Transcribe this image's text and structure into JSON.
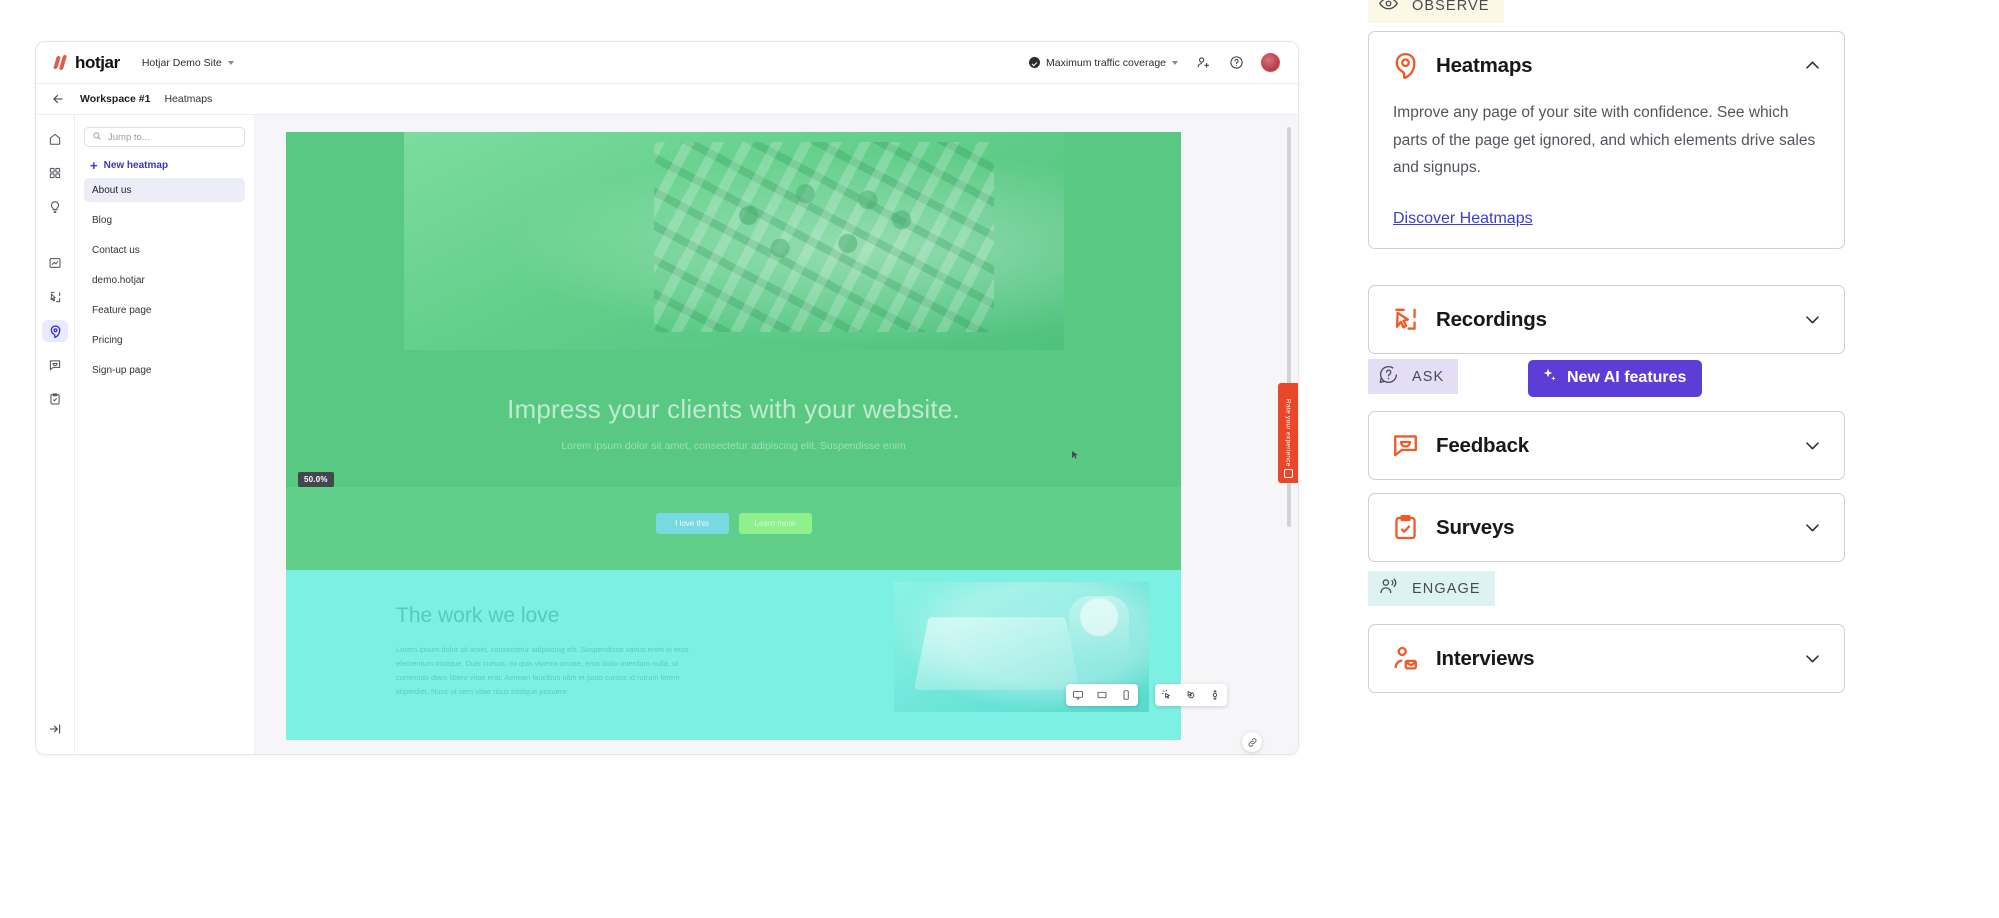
{
  "app": {
    "logo_text": "hotjar",
    "site_selector": "Hotjar Demo Site",
    "traffic_coverage": "Maximum traffic coverage",
    "icons": {
      "site_caret": "chevron-down-icon",
      "coverage_check": "check-circle-icon",
      "invite": "add-user-icon",
      "help": "help-circle-icon",
      "avatar": "user-avatar"
    },
    "breadcrumb": {
      "back": "back-arrow-icon",
      "workspace": "Workspace #1",
      "section": "Heatmaps"
    },
    "rail": [
      {
        "name": "home-icon"
      },
      {
        "name": "dashboard-grid-icon"
      },
      {
        "name": "lightbulb-icon"
      },
      {
        "name": "trends-chart-icon"
      },
      {
        "name": "recordings-icon"
      },
      {
        "name": "heatmaps-icon",
        "active": true
      },
      {
        "name": "feedback-icon"
      },
      {
        "name": "surveys-icon"
      }
    ],
    "rail_collapse": "collapse-panel-icon",
    "pagelist": {
      "search_placeholder": "Jump to...",
      "search_value": "",
      "new_heatmap": "New heatmap",
      "items": [
        {
          "label": "About us",
          "active": true
        },
        {
          "label": "Blog",
          "active": false
        },
        {
          "label": "Contact us",
          "active": false
        },
        {
          "label": "demo.hotjar",
          "active": false
        },
        {
          "label": "Feature page",
          "active": false
        },
        {
          "label": "Pricing",
          "active": false
        },
        {
          "label": "Sign-up page",
          "active": false
        }
      ]
    },
    "heatmap_preview": {
      "hero_heading": "Impress your clients with your website.",
      "hero_sub": "Lorem ipsum dolor sit amet, consectetur adipiscing elit. Suspendisse enim",
      "scroll_badge": "50.0%",
      "cta_primary": "I love this",
      "cta_secondary": "Learn more",
      "section_heading": "The work we love",
      "section_paragraph": "Lorem ipsum dolor sit amet, consectetur adipiscing elit. Suspendisse varius enim in eros elementum tristique. Duis cursus, mi quis viverra ornare, eros dolor interdum nulla, ut commodo diam libero vitae erat. Aenean faucibus nibh et justo cursus id rutrum lorem imperdiet. Nunc ut sem vitae risus tristique posuere.",
      "rate_tab": "Rate your experience",
      "device_toolbar": [
        {
          "name": "desktop-icon"
        },
        {
          "name": "tablet-icon"
        },
        {
          "name": "mobile-icon"
        }
      ],
      "type_toolbar": [
        {
          "name": "click-heatmap-icon"
        },
        {
          "name": "move-heatmap-icon"
        },
        {
          "name": "scroll-heatmap-icon"
        }
      ],
      "share_link": "share-link-icon"
    }
  },
  "panel": {
    "sections": {
      "observe": {
        "label": "OBSERVE",
        "icon": "eye-icon"
      },
      "ask": {
        "label": "ASK",
        "icon": "question-bubble-icon"
      },
      "engage": {
        "label": "ENGAGE",
        "icon": "people-icon"
      }
    },
    "ai_badge": {
      "label": "New AI features",
      "icon": "sparkle-icon",
      "color": "#5b3ed6"
    },
    "cards": [
      {
        "id": "heatmaps",
        "title": "Heatmaps",
        "icon": "heatmaps-icon",
        "expanded": true,
        "chevron": "chevron-up-icon",
        "description": "Improve any page of your site with confidence. See which parts of the page get ignored, and which elements drive sales and signups.",
        "link": "Discover Heatmaps"
      },
      {
        "id": "recordings",
        "title": "Recordings",
        "icon": "recordings-cursor-icon",
        "expanded": false,
        "chevron": "chevron-down-icon"
      },
      {
        "id": "feedback",
        "title": "Feedback",
        "icon": "feedback-bubble-icon",
        "expanded": false,
        "chevron": "chevron-down-icon"
      },
      {
        "id": "surveys",
        "title": "Surveys",
        "icon": "surveys-clipboard-icon",
        "expanded": false,
        "chevron": "chevron-down-icon"
      },
      {
        "id": "interviews",
        "title": "Interviews",
        "icon": "interviews-person-mail-icon",
        "expanded": false,
        "chevron": "chevron-down-icon"
      }
    ],
    "colors": {
      "brand_orange": "#ef5a27",
      "link_blue": "#3d3ad6",
      "ai_purple": "#5b3ed6",
      "observe_bg": "#fbf8e6",
      "ask_bg": "#e3def5",
      "engage_bg": "#dcf3f2"
    }
  }
}
